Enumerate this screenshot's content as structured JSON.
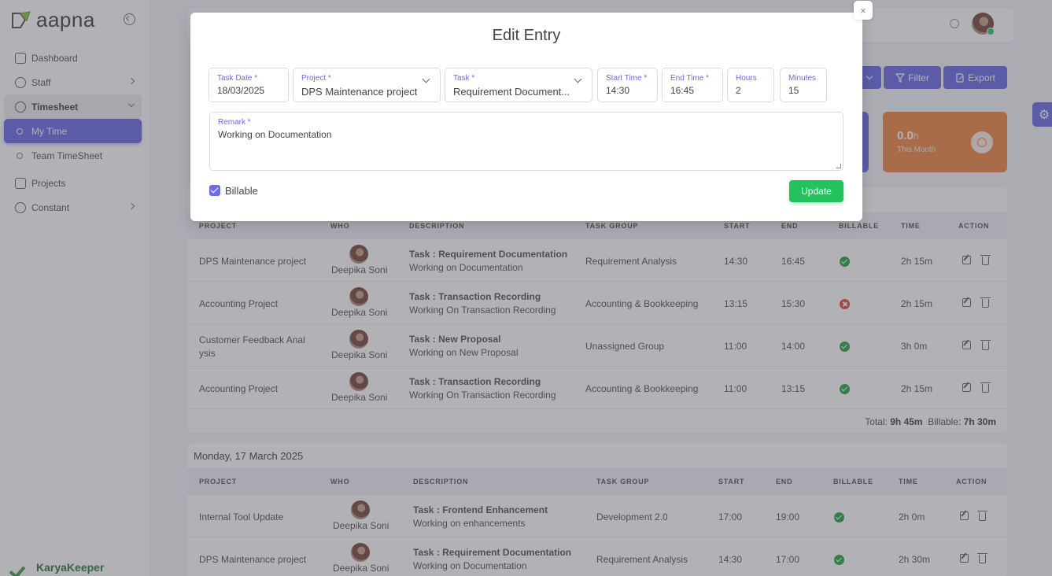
{
  "brand": {
    "logo_text": "aapna",
    "footer_text": "KaryaKeeper"
  },
  "sidebar": {
    "items": [
      {
        "label": "Dashboard"
      },
      {
        "label": "Staff"
      },
      {
        "label": "Timesheet"
      },
      {
        "label": "My Time"
      },
      {
        "label": "Team TimeSheet"
      },
      {
        "label": "Projects"
      },
      {
        "label": "Constant"
      }
    ]
  },
  "toolbar": {
    "filter_label": "Filter",
    "export_label": "Export"
  },
  "stat_card": {
    "value": "0.0",
    "unit": "h",
    "label": "This Month"
  },
  "modal": {
    "title": "Edit Entry",
    "close_label": "×",
    "fields": {
      "task_date": {
        "label": "Task Date *",
        "value": "18/03/2025"
      },
      "project": {
        "label": "Project *",
        "value": "DPS Maintenance project"
      },
      "task": {
        "label": "Task *",
        "value": "Requirement Document..."
      },
      "start_time": {
        "label": "Start Time *",
        "value": "14:30"
      },
      "end_time": {
        "label": "End Time *",
        "value": "16:45"
      },
      "hours": {
        "label": "Hours",
        "value": "2"
      },
      "minutes": {
        "label": "Minutes",
        "value": "15"
      },
      "remark": {
        "label": "Remark *",
        "value": "Working on Documentation"
      }
    },
    "billable_label": "Billable",
    "update_label": "Update"
  },
  "table_headers": {
    "project": "PROJECT",
    "who": "WHO",
    "description": "DESCRIPTION",
    "task_group": "TASK GROUP",
    "start": "START",
    "end": "END",
    "billable": "BILLABLE",
    "time": "TIME",
    "action": "ACTION"
  },
  "day1": {
    "rows": [
      {
        "project": "DPS Maintenance project",
        "who": "Deepika Soni",
        "task": "Task : Requirement Documentation",
        "note": "Working on Documentation",
        "group": "Requirement Analysis",
        "start": "14:30",
        "end": "16:45",
        "billable": true,
        "time": "2h 15m"
      },
      {
        "project": "Accounting Project",
        "who": "Deepika Soni",
        "task": "Task : Transaction Recording",
        "note": "Working On Transaction Recording",
        "group": "Accounting & Bookkeeping",
        "start": "13:15",
        "end": "15:30",
        "billable": false,
        "time": "2h 15m"
      },
      {
        "project": "Customer Feedback Anal ysis",
        "who": "Deepika Soni",
        "task": "Task : New Proposal",
        "note": "Working on New Proposal",
        "group": "Unassigned Group",
        "start": "11:00",
        "end": "14:00",
        "billable": true,
        "time": "3h 0m"
      },
      {
        "project": "Accounting Project",
        "who": "Deepika Soni",
        "task": "Task : Transaction Recording",
        "note": "Working On Transaction Recording",
        "group": "Accounting & Bookkeeping",
        "start": "11:00",
        "end": "13:15",
        "billable": true,
        "time": "2h 15m"
      }
    ],
    "total_label": "Total:",
    "total_value": "9h 45m",
    "billable_total_label": "Billable:",
    "billable_total_value": "7h 30m"
  },
  "day2": {
    "heading": "Monday, 17 March 2025",
    "rows": [
      {
        "project": "Internal Tool Update",
        "who": "Deepika Soni",
        "task": "Task : Frontend Enhancement",
        "note": "Working on enhancements",
        "group": "Development 2.0",
        "start": "17:00",
        "end": "19:00",
        "billable": true,
        "time": "2h 0m"
      },
      {
        "project": "DPS Maintenance project",
        "who": "Deepika Soni",
        "task": "Task : Requirement Documentation",
        "note": "Working on Documentation",
        "group": "Requirement Analysis",
        "start": "14:30",
        "end": "17:00",
        "billable": true,
        "time": "2h 30m"
      }
    ]
  }
}
